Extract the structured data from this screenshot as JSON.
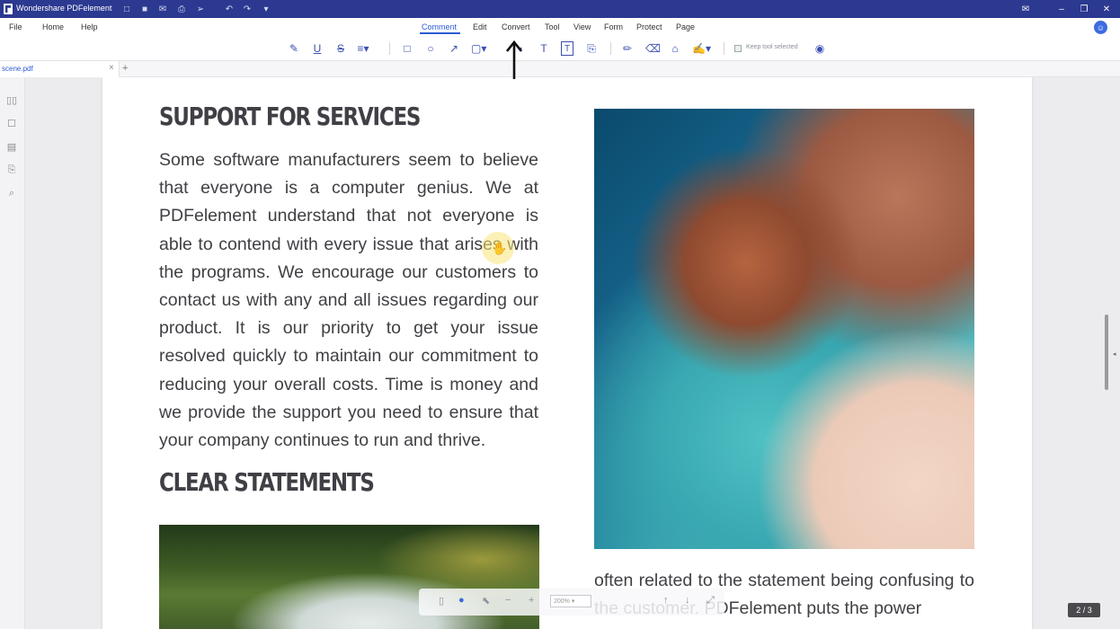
{
  "window": {
    "app_title": "Wondershare PDFelement",
    "colors": {
      "titlebar": "#2b3990",
      "accent": "#2b5cd6"
    }
  },
  "menubar": {
    "file": "File",
    "home": "Home",
    "help": "Help",
    "tabs": [
      {
        "label": "Comment",
        "active": true
      },
      {
        "label": "Edit"
      },
      {
        "label": "Convert"
      },
      {
        "label": "Tool"
      },
      {
        "label": "View"
      },
      {
        "label": "Form"
      },
      {
        "label": "Protect"
      },
      {
        "label": "Page"
      }
    ]
  },
  "toolbar": {
    "keep_tool_selected": "Keep tool selected",
    "icons": [
      "highlight-icon",
      "underline-icon",
      "strikethrough-icon",
      "text-lines-icon",
      "rectangle-icon",
      "circle-icon",
      "arrow-icon",
      "shapes-icon",
      "note-icon",
      "text-icon",
      "textbox-icon",
      "attachment-icon",
      "pencil-icon",
      "eraser-icon",
      "stamp-icon",
      "signature-icon",
      "eye-icon"
    ]
  },
  "doc_tab": {
    "name": "scene.pdf"
  },
  "document": {
    "heading1": "SUPPORT FOR SERVICES",
    "paragraph1": "Some software manufacturers seem to believe that everyone is a computer genius. We at PDFelement understand that not everyone is able to contend with every issue that arises with the programs. We encourage our customers to contact us with any and all issues regarding our product. It is our priority to get your issue resolved quickly to maintain our commitment to reducing your overall costs. Time is money and we provide the support you need to ensure that your company continues to run and thrive.",
    "heading2": "CLEAR STATEMENTS",
    "paragraph2": "often related to the statement being confusing to the customer. PDFelement puts the power"
  },
  "status": {
    "zoom": "200%",
    "page_indicator": "2 / 3"
  }
}
